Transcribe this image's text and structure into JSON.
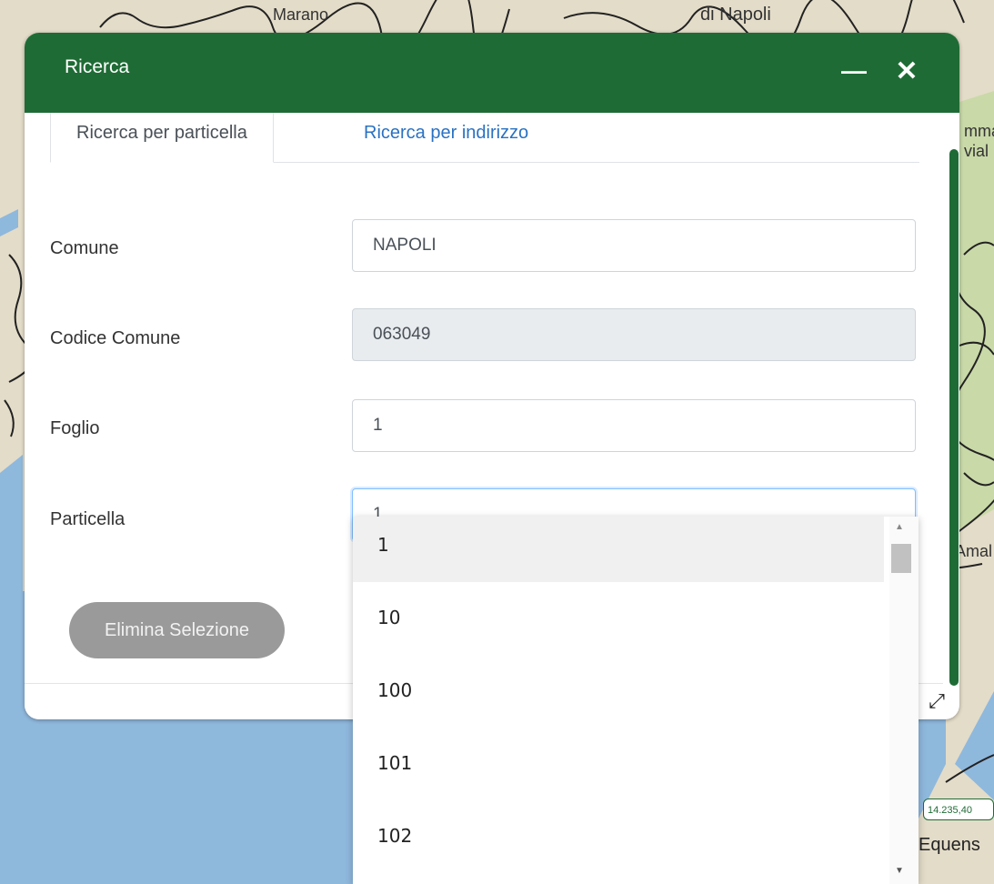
{
  "map": {
    "labels": {
      "marano": "Marano",
      "napoli": "di Napoli",
      "amalfi": "Amal",
      "equense": "Equens",
      "mma": "mma",
      "via": "vial"
    },
    "coordinates": "14.235,40",
    "colors": {
      "land": "#e3dcc8",
      "sea": "#8fb8dd",
      "green": "#c9d9a8"
    }
  },
  "dialog": {
    "title": "Ricerca",
    "minimize_icon": "minus-icon",
    "close_icon": "close-icon",
    "header_color": "#1f6b35",
    "tabs": [
      {
        "label": "Ricerca per particella",
        "active": true
      },
      {
        "label": "Ricerca per indirizzo",
        "active": false
      }
    ],
    "form": {
      "comune": {
        "label": "Comune",
        "value": "NAPOLI"
      },
      "codice_comune": {
        "label": "Codice Comune",
        "value": "063049"
      },
      "foglio": {
        "label": "Foglio",
        "value": "1"
      },
      "particella": {
        "label": "Particella",
        "value": "1"
      }
    },
    "clear_button": "Elimina Selezione",
    "resize_icon": "resize-icon"
  },
  "dropdown": {
    "options": [
      "1",
      "10",
      "100",
      "101",
      "102"
    ],
    "selected": "1"
  }
}
